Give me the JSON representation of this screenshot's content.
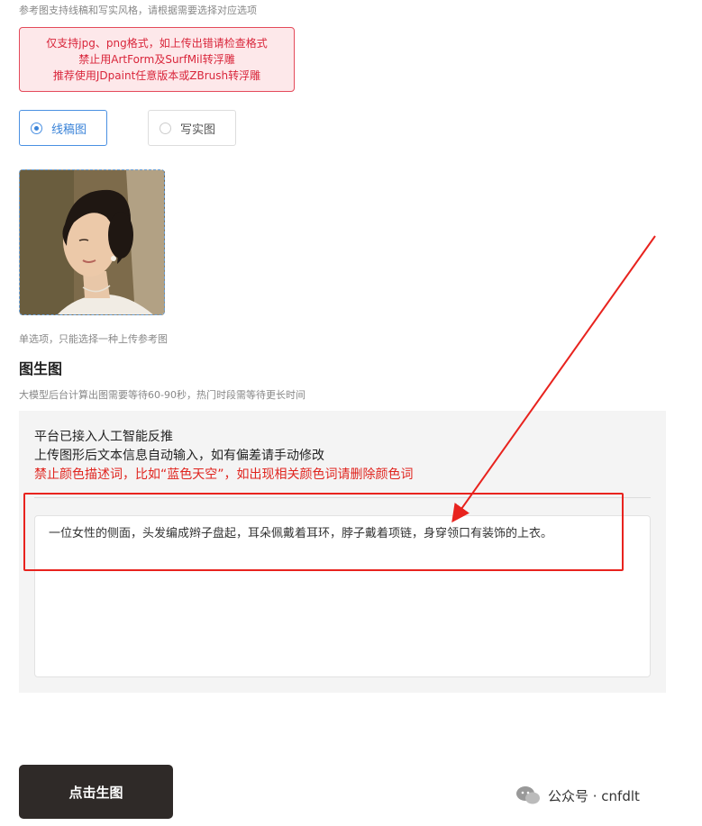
{
  "hints": {
    "top": "参考图支持线稿和写实风格，请根据需要选择对应选项",
    "single_choice": "单选项，只能选择一种上传参考图",
    "wait_time": "大模型后台计算出图需要等待60-90秒，热门时段需等待更长时间"
  },
  "warning": {
    "line1": "仅支持jpg、png格式，如上传出错请检查格式",
    "line2": "禁止用ArtForm及SurfMil转浮雕",
    "line3": "推荐使用JDpaint任意版本或ZBrush转浮雕"
  },
  "mode_options": [
    {
      "label": "线稿图",
      "selected": true
    },
    {
      "label": "写实图",
      "selected": false
    }
  ],
  "section": {
    "title": "图生图"
  },
  "panel": {
    "line1": "平台已接入人工智能反推",
    "line2": "上传图形后文本信息自动输入，如有偏差请手动修改",
    "line3": "禁止颜色描述词，比如“蓝色天空”，如出现相关颜色词请删除颜色词"
  },
  "prompt_text": "一位女性的侧面，头发编成辫子盘起，耳朵佩戴着耳环，脖子戴着项链，身穿领口有装饰的上衣。",
  "generate_button": "点击生图",
  "watermark": "公众号 · cnfdlt",
  "colors": {
    "accent": "#3a83d8",
    "warning": "#e0251f",
    "button_bg": "#2f2a28"
  }
}
